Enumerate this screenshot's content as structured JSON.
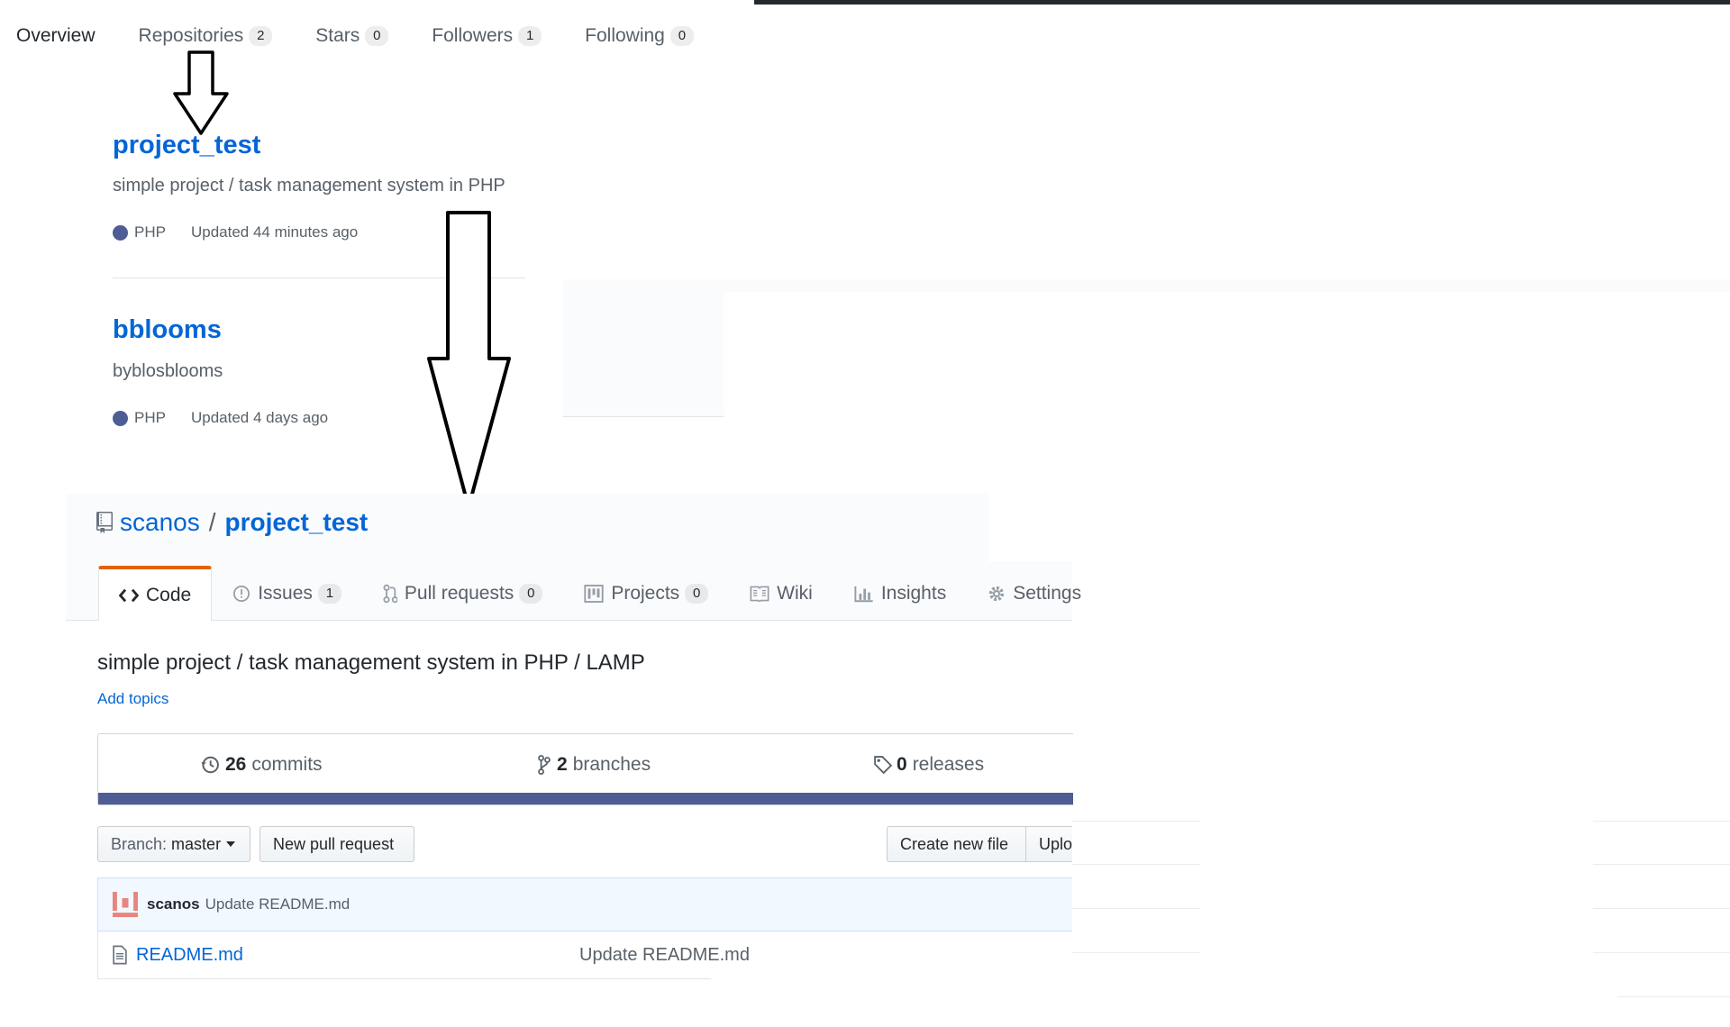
{
  "profile_nav": {
    "items": [
      {
        "label": "Overview",
        "count": null
      },
      {
        "label": "Repositories",
        "count": "2"
      },
      {
        "label": "Stars",
        "count": "0"
      },
      {
        "label": "Followers",
        "count": "1"
      },
      {
        "label": "Following",
        "count": "0"
      }
    ]
  },
  "repos": [
    {
      "name": "project_test",
      "description": "simple project / task management system in PHP",
      "language": "PHP",
      "updated": "Updated 44 minutes ago"
    },
    {
      "name": "bblooms",
      "description": "byblosblooms",
      "language": "PHP",
      "updated": "Updated 4 days ago"
    }
  ],
  "colors": {
    "php": "#4f5d95",
    "link": "#0366d6",
    "tab_accent": "#e36209"
  },
  "repo_page": {
    "owner": "scanos",
    "separator": "/",
    "name": "project_test",
    "tabs": [
      {
        "label": "Code",
        "icon": "code-icon",
        "count": null
      },
      {
        "label": "Issues",
        "icon": "issue-icon",
        "count": "1"
      },
      {
        "label": "Pull requests",
        "icon": "pull-request-icon",
        "count": "0"
      },
      {
        "label": "Projects",
        "icon": "project-icon",
        "count": "0"
      },
      {
        "label": "Wiki",
        "icon": "book-icon",
        "count": null
      },
      {
        "label": "Insights",
        "icon": "graph-icon",
        "count": null
      },
      {
        "label": "Settings",
        "icon": "gear-icon",
        "count": null
      }
    ],
    "description": "simple project / task management system in PHP / LAMP",
    "add_topics": "Add topics",
    "summary": {
      "commits_count": "26",
      "commits_label": "commits",
      "branches_count": "2",
      "branches_label": "branches",
      "releases_count": "0",
      "releases_label": "releases"
    },
    "branch_prefix": "Branch:",
    "branch": "master",
    "new_pull_request": "New pull request",
    "create_new_file": "Create new file",
    "upload_files": "Uplo",
    "latest_commit": {
      "author": "scanos",
      "message": "Update README.md"
    },
    "files": [
      {
        "name": "README.md",
        "message": "Update README.md"
      }
    ]
  }
}
